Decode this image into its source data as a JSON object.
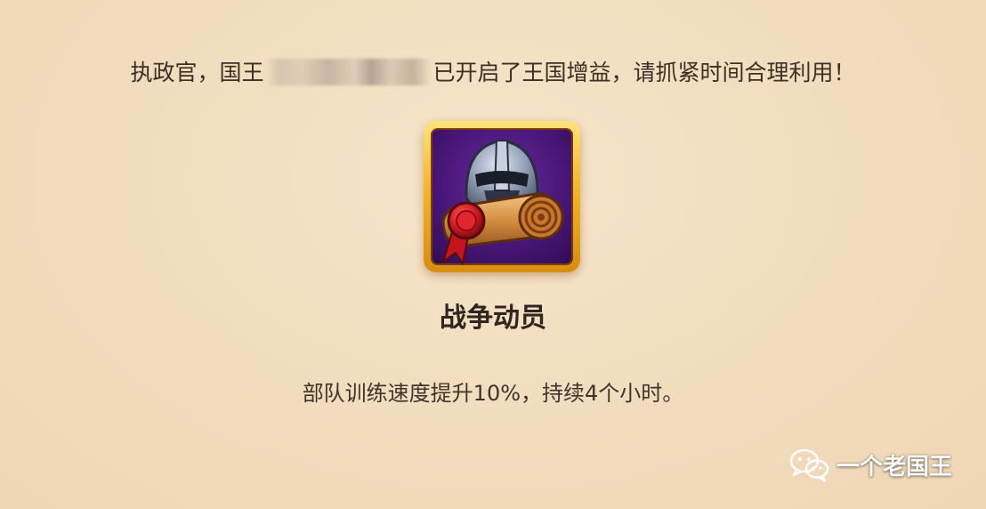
{
  "notice": {
    "prefix": "执政官，国王",
    "suffix": "已开启了王国增益，请抓紧时间合理利用！"
  },
  "buff": {
    "icon": "war-mobilization-helmet-scroll-icon",
    "title": "战争动员",
    "description": "部队训练速度提升10%，持续4个小时。"
  },
  "watermark": {
    "icon": "wechat-icon",
    "text": "一个老国王"
  },
  "colors": {
    "background": "#f2dcbd",
    "frame_gold": "#f3b526",
    "icon_purple": "#4a177a",
    "text": "#3a2e25"
  }
}
